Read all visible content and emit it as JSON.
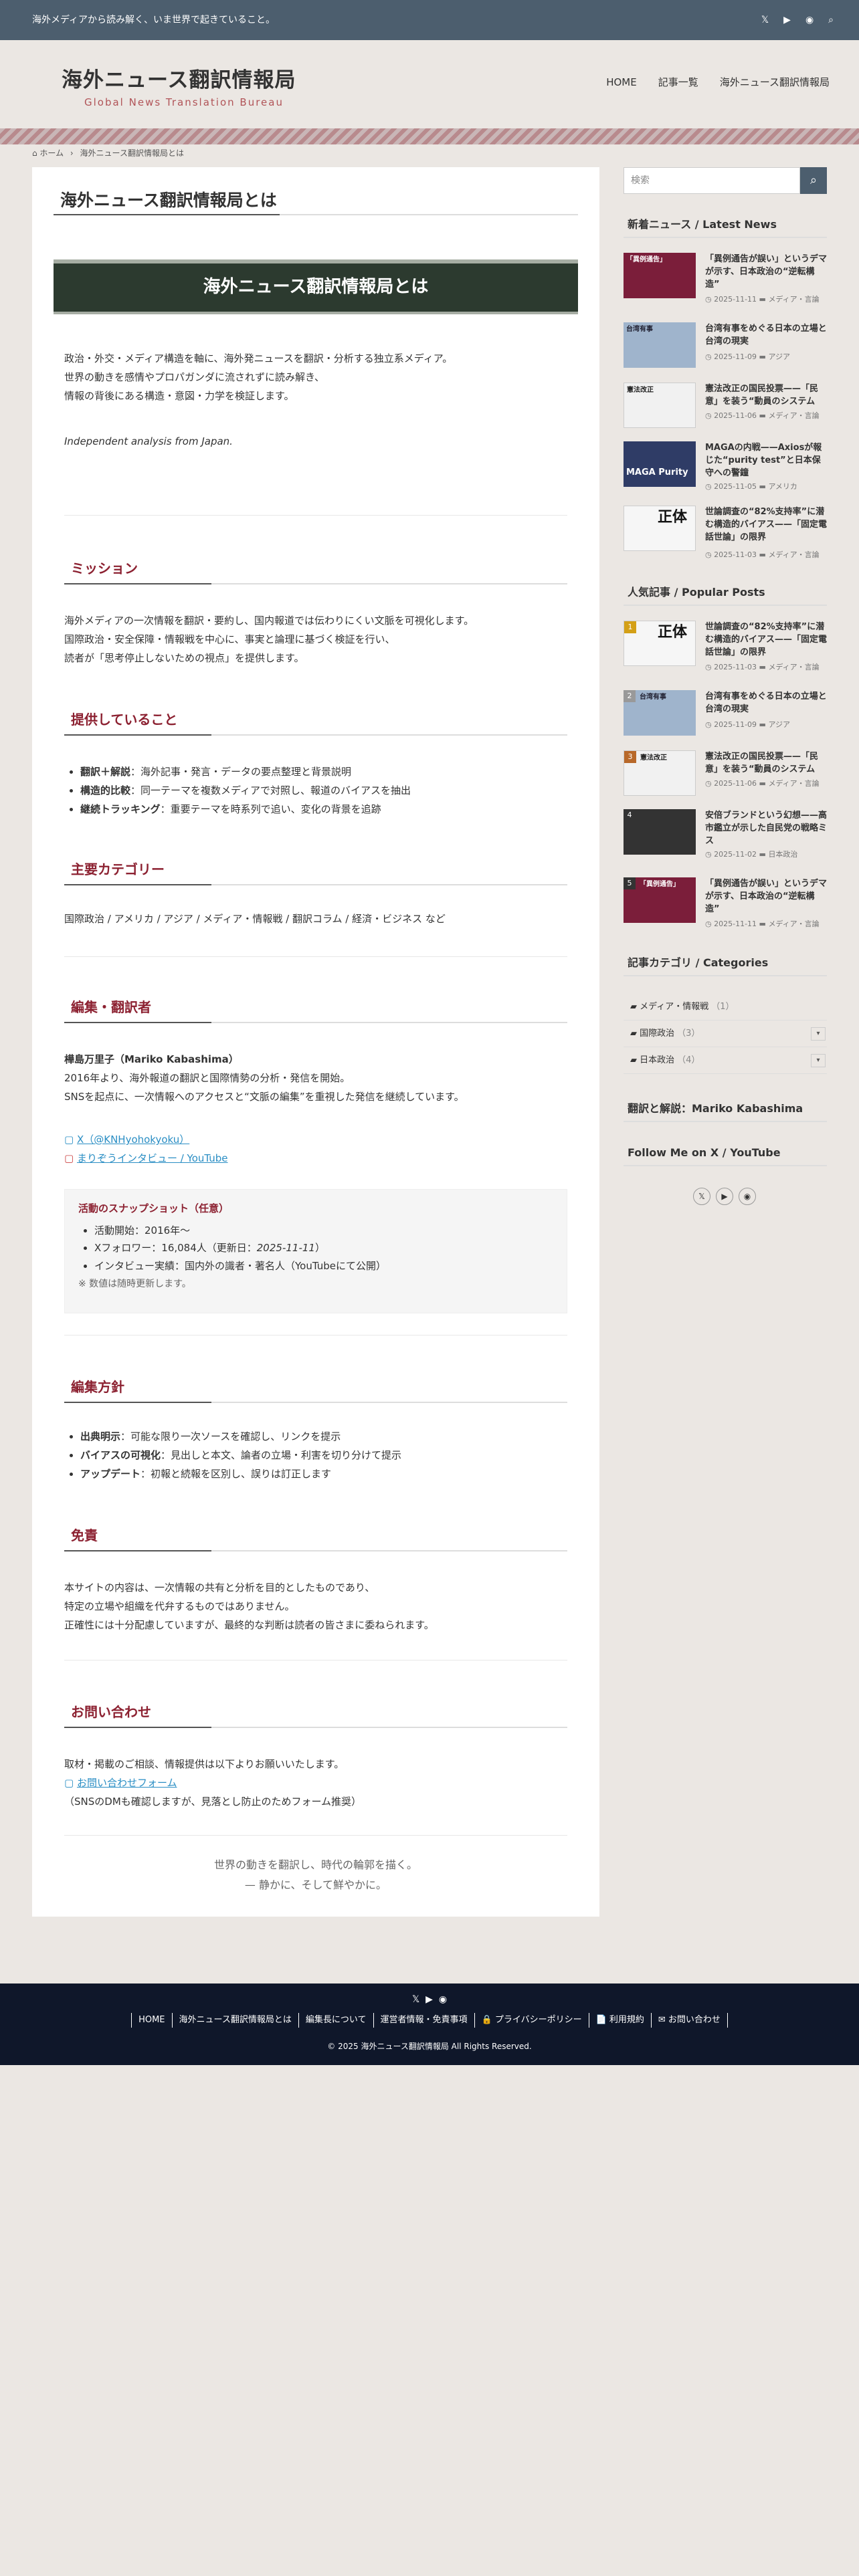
{
  "topbar": {
    "message": "海外メディアから読み解く、いま世界で起きていること。"
  },
  "header": {
    "title": "海外ニュース翻訳情報局",
    "subtitle": "Global News Translation Bureau",
    "nav": [
      "HOME",
      "記事一覧",
      "海外ニュース翻訳情報局"
    ]
  },
  "breadcrumb": {
    "home": "⌂ ホーム",
    "sep": "›",
    "current": "海外ニュース翻訳情報局とは"
  },
  "page": {
    "title": "海外ニュース翻訳情報局とは",
    "banner": "海外ニュース翻訳情報局とは",
    "intro": [
      "政治・外交・メディア構造を軸に、海外発ニュースを翻訳・分析する独立系メディア。",
      "世界の動きを感情やプロパガンダに流されずに読み解き、",
      "情報の背後にある構造・意図・力学を検証します。"
    ],
    "tagline": "Independent analysis from Japan.",
    "mission_heading": "ミッション",
    "mission": [
      "海外メディアの一次情報を翻訳・要約し、国内報道では伝わりにくい文脈を可視化します。",
      "国際政治・安全保障・情報戦を中心に、事実と論理に基づく検証を行い、",
      "読者が「思考停止しないための視点」を提供します。"
    ],
    "offer_heading": "提供していること",
    "offer": [
      {
        "b": "翻訳＋解説",
        "t": "：海外記事・発言・データの要点整理と背景説明"
      },
      {
        "b": "構造的比較",
        "t": "：同一テーマを複数メディアで対照し、報道のバイアスを抽出"
      },
      {
        "b": "継続トラッキング",
        "t": "：重要テーマを時系列で追い、変化の背景を追跡"
      }
    ],
    "cat_heading": "主要カテゴリー",
    "categories": "国際政治 / アメリカ / アジア / メディア・情報戦 / 翻訳コラム / 経済・ビジネス など",
    "editor_heading": "編集・翻訳者",
    "editor_name": "樺島万里子（Mariko Kabashima）",
    "editor_bio": [
      "2016年より、海外報道の翻訳と国際情勢の分析・発信を開始。",
      "SNSを起点に、一次情報へのアクセスと“文脈の編集”を重視した発信を継続しています。"
    ],
    "link_x": "X（@KNHyohokyoku）",
    "link_yt": "まりぞうインタビュー / YouTube",
    "snap_title": "活動のスナップショット（任意）",
    "snap_items": [
      "活動開始：2016年〜",
      "Xフォロワー：16,084人（更新日：",
      "インタビュー実績：国内外の識者・著名人（YouTubeにて公開）"
    ],
    "snap_date": "2025-11-11",
    "snap_close": "）",
    "snap_note": "※ 数値は随時更新します。",
    "policy_heading": "編集方針",
    "policy": [
      {
        "b": "出典明示",
        "t": "：可能な限り一次ソースを確認し、リンクを提示"
      },
      {
        "b": "バイアスの可視化",
        "t": "：見出しと本文、論者の立場・利害を切り分けて提示"
      },
      {
        "b": "アップデート",
        "t": "：初報と続報を区別し、誤りは訂正します"
      }
    ],
    "disclaimer_heading": "免責",
    "disclaimer": [
      "本サイトの内容は、一次情報の共有と分析を目的としたものであり、",
      "特定の立場や組織を代弁するものではありません。",
      "正確性には十分配慮していますが、最終的な判断は読者の皆さまに委ねられます。"
    ],
    "contact_heading": "お問い合わせ",
    "contact_text": "取材・掲載のご相談、情報提供は以下よりお願いいたします。",
    "contact_link": "お問い合わせフォーム",
    "contact_note": "（SNSのDMも確認しますが、見落とし防止のためフォーム推奨）",
    "closing": [
      "世界の動きを翻訳し、時代の輪郭を描く。",
      "— 静かに、そして鮮やかに。"
    ]
  },
  "sidebar": {
    "search_placeholder": "検索",
    "latest_title": "新着ニュース / Latest News",
    "latest": [
      {
        "title": "「異例通告が誤い」というデマが示す、日本政治の“逆転構造”",
        "date": "2025-11-11",
        "cat": "メディア・言論"
      },
      {
        "title": "台湾有事をめぐる日本の立場と台湾の現実",
        "date": "2025-11-09",
        "cat": "アジア"
      },
      {
        "title": "憲法改正の国民投票——「民意」を装う“動員のシステム",
        "date": "2025-11-06",
        "cat": "メディア・言論"
      },
      {
        "title": "MAGAの内戦——Axiosが報じた“purity test”と日本保守への警鐘",
        "date": "2025-11-05",
        "cat": "アメリカ"
      },
      {
        "title": "世論調査の“82%支持率”に潜む構造的バイアス——「固定電話世論」の限界",
        "date": "2025-11-03",
        "cat": "メディア・言論"
      }
    ],
    "popular_title": "人気記事 / Popular Posts",
    "popular": [
      {
        "title": "世論調査の“82%支持率”に潜む構造的バイアス——「固定電話世論」の限界",
        "date": "2025-11-03",
        "cat": "メディア・言論",
        "rank": "1"
      },
      {
        "title": "台湾有事をめぐる日本の立場と台湾の現実",
        "date": "2025-11-09",
        "cat": "アジア",
        "rank": "2"
      },
      {
        "title": "憲法改正の国民投票——「民意」を装う“動員のシステム",
        "date": "2025-11-06",
        "cat": "メディア・言論",
        "rank": "3"
      },
      {
        "title": "安倍ブランドという幻想——高市鑑立が示した自民党の戦略ミス",
        "date": "2025-11-02",
        "cat": "日本政治",
        "rank": "4"
      },
      {
        "title": "「異例通告が誤い」というデマが示す、日本政治の“逆転構造”",
        "date": "2025-11-11",
        "cat": "メディア・言論",
        "rank": "5"
      }
    ],
    "categories_title": "記事カテゴリ / Categories",
    "categories": [
      {
        "name": "メディア・情報戦",
        "count": "（1）"
      },
      {
        "name": "国際政治",
        "count": "（3）"
      },
      {
        "name": "日本政治",
        "count": "（4）"
      }
    ],
    "profile_title": "翻訳と解説：Mariko Kabashima",
    "follow_title": "Follow Me on X / YouTube"
  },
  "footer": {
    "nav": [
      "HOME",
      "海外ニュース翻訳情報局とは",
      "編集長について",
      "運営者情報・免責事項",
      "🔒 プライバシーポリシー",
      "📄 利用規約",
      "✉ お問い合わせ"
    ],
    "copyright": "© 2025 海外ニュース翻訳情報局 All Rights Reserved."
  },
  "thumb_text": [
    "「異例通告」",
    "台湾有事",
    "憲法改正",
    "MAGA Purity",
    "正体",
    "正体",
    "台湾有事",
    "憲法改正",
    "",
    ""
  ]
}
